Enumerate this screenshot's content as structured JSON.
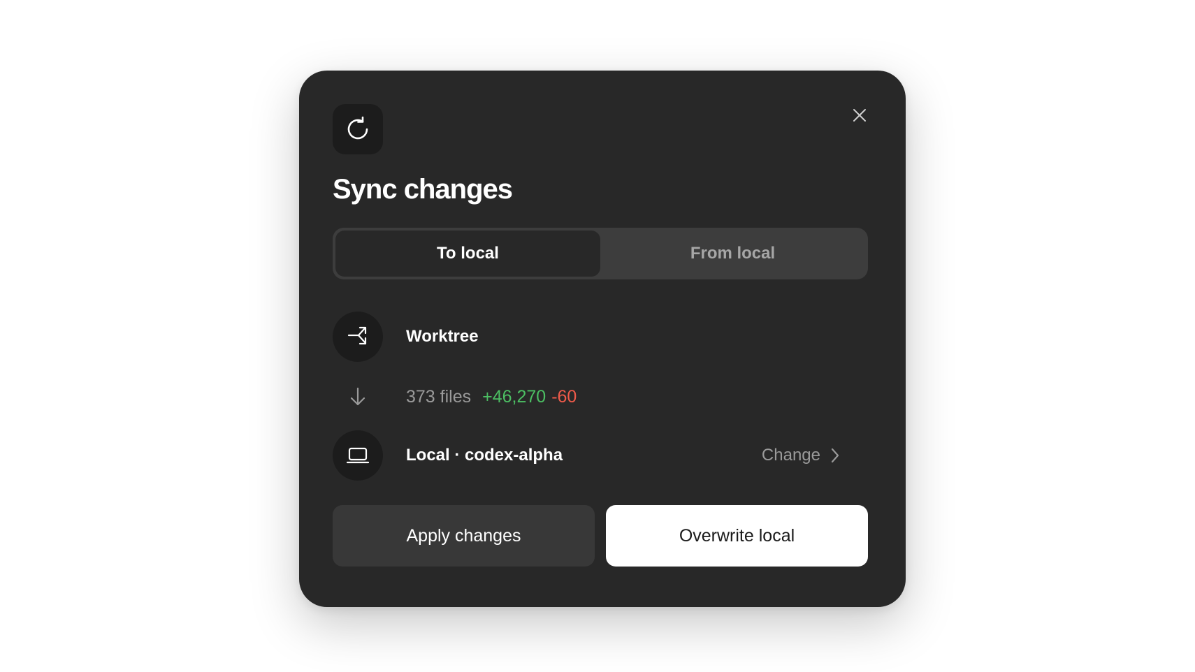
{
  "dialog": {
    "header_icon": "sync-refresh-icon",
    "close_icon": "close-icon",
    "title": "Sync changes"
  },
  "tabs": [
    {
      "label": "To local",
      "active": true
    },
    {
      "label": "From local",
      "active": false
    }
  ],
  "source": {
    "icon": "worktree-branch-icon",
    "label": "Worktree"
  },
  "diff": {
    "icon": "arrow-down-icon",
    "files": "373 files",
    "additions": "+46,270",
    "deletions": "-60"
  },
  "target": {
    "icon": "laptop-icon",
    "label": "Local · codex-alpha",
    "change_label": "Change",
    "change_icon": "chevron-right-icon"
  },
  "actions": {
    "apply_label": "Apply changes",
    "overwrite_label": "Overwrite local"
  },
  "colors": {
    "dialog_bg": "#282828",
    "additions": "#4cbf63",
    "deletions": "#ef5a4a",
    "muted_text": "#9a9a9a"
  }
}
